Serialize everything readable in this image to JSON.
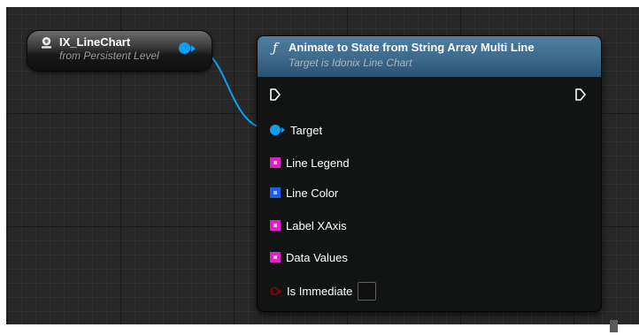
{
  "variable_node": {
    "title": "IX_LineChart",
    "subtitle": "from Persistent Level"
  },
  "function_node": {
    "symbol": "ƒ",
    "title": "Animate to State from String Array Multi Line",
    "subtitle": "Target is Idonix Line Chart",
    "pins": {
      "target": "Target",
      "line_legend": "Line Legend",
      "line_color": "Line Color",
      "label_xaxis": "Label XAxis",
      "data_values": "Data Values",
      "is_immediate": "Is Immediate"
    }
  },
  "colors": {
    "object_pin": "#129ef0",
    "string_array": "#e020c0",
    "color_array": "#1f60e0",
    "bool": "#940000",
    "node_header": "#3c6a8a"
  },
  "icons": {
    "variable": "world-icon",
    "exec": "exec-arrow-icon",
    "array": "array-grid-icon",
    "bool": "bool-pin-icon"
  }
}
